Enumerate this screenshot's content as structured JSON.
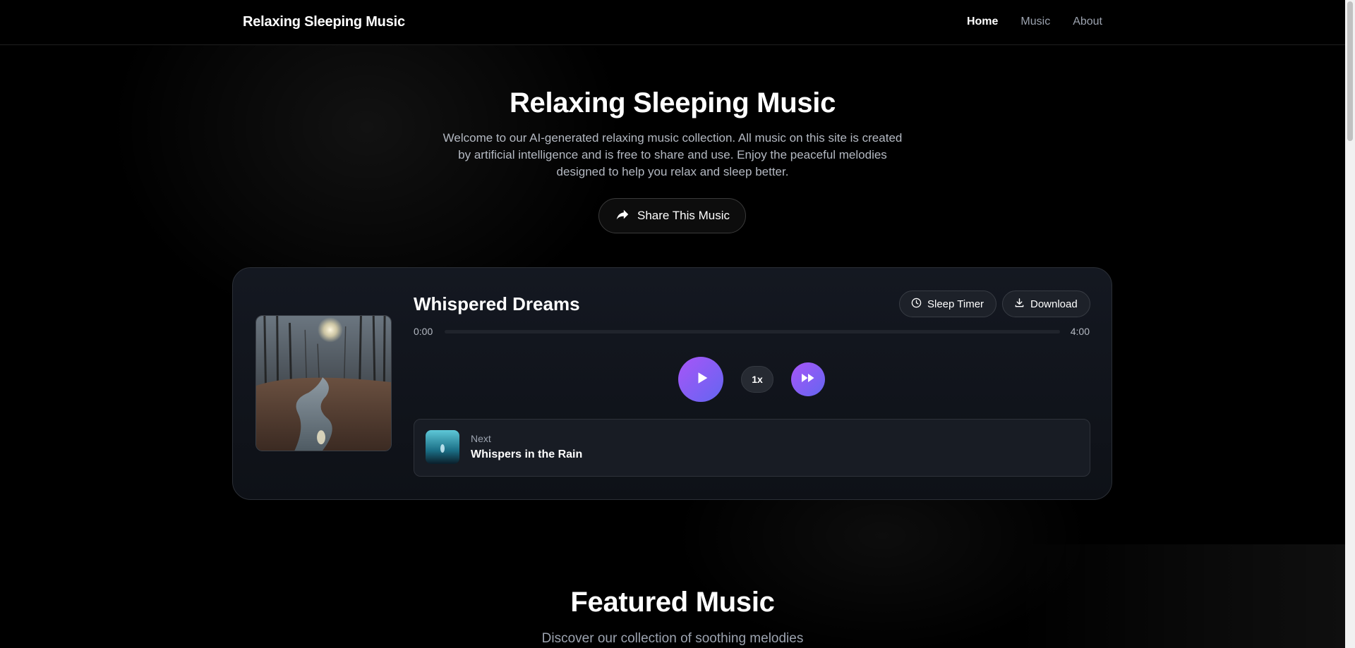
{
  "nav": {
    "brand": "Relaxing Sleeping Music",
    "links": [
      {
        "label": "Home",
        "active": true
      },
      {
        "label": "Music",
        "active": false
      },
      {
        "label": "About",
        "active": false
      }
    ]
  },
  "hero": {
    "title": "Relaxing Sleeping Music",
    "description": "Welcome to our AI-generated relaxing music collection. All music on this site is created by artificial intelligence and is free to share and use. Enjoy the peaceful melodies designed to help you relax and sleep better.",
    "share_label": "Share This Music",
    "share_icon": "share-icon"
  },
  "player": {
    "title": "Whispered Dreams",
    "sleep_timer_label": "Sleep Timer",
    "download_label": "Download",
    "current_time": "0:00",
    "total_time": "4:00",
    "progress_fraction": 0,
    "speed_label": "1x",
    "next": {
      "label": "Next",
      "title": "Whispers in the Rain"
    }
  },
  "featured": {
    "title": "Featured Music",
    "subtitle": "Discover our collection of soothing melodies"
  },
  "colors": {
    "accent_start": "#a855f7",
    "accent_end": "#6366f1",
    "background": "#000000",
    "card": "#141821"
  }
}
